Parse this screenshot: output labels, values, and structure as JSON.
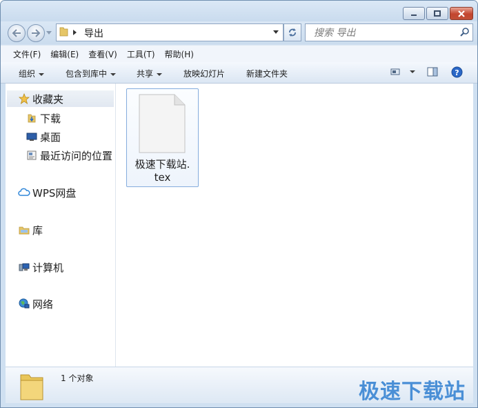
{
  "address": {
    "folder": "导出"
  },
  "search": {
    "placeholder": "搜索 导出"
  },
  "menu": [
    "文件(F)",
    "编辑(E)",
    "查看(V)",
    "工具(T)",
    "帮助(H)"
  ],
  "toolbar": {
    "organize": "组织",
    "include_library": "包含到库中",
    "share": "共享",
    "slideshow": "放映幻灯片",
    "new_folder": "新建文件夹"
  },
  "sidebar": {
    "favorites": "收藏夹",
    "downloads": "下载",
    "desktop": "桌面",
    "recent": "最近访问的位置",
    "wps": "WPS网盘",
    "libraries": "库",
    "computer": "计算机",
    "network": "网络"
  },
  "files": [
    {
      "name_line1": "极速下载站.",
      "name_line2": "tex"
    }
  ],
  "status": {
    "count": "1 个对象"
  },
  "watermark": "极速下载站"
}
